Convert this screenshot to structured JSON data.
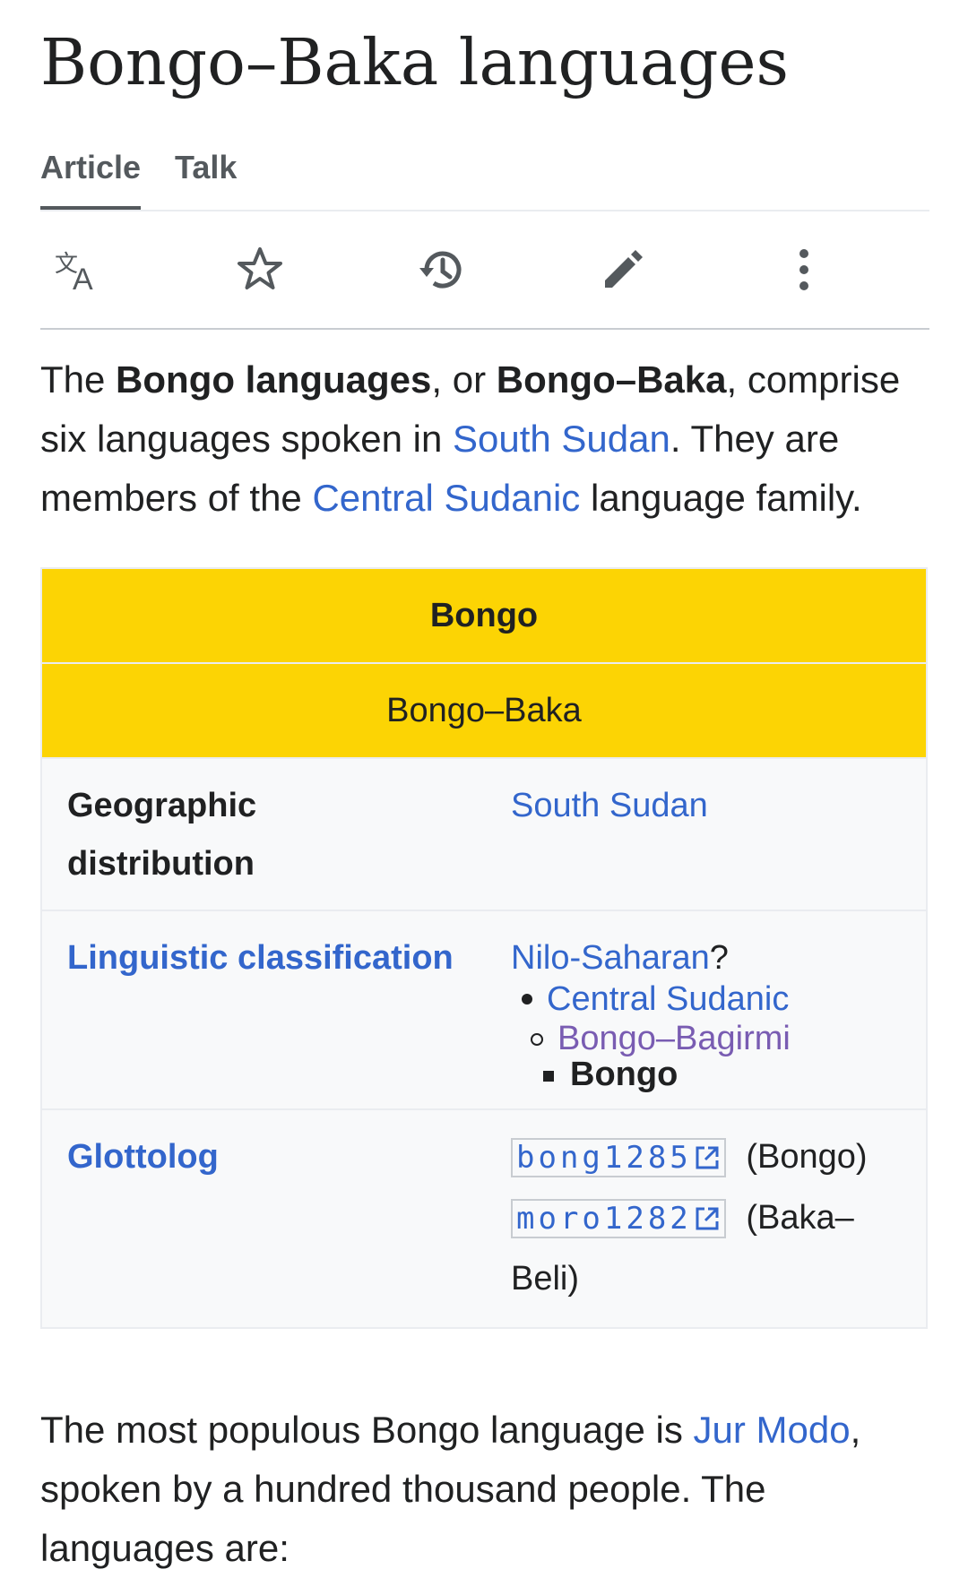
{
  "page": {
    "title": "Bongo–Baka languages"
  },
  "tabs": [
    {
      "label": "Article",
      "active": true
    },
    {
      "label": "Talk",
      "active": false
    }
  ],
  "toolbar": {
    "icons": [
      "language-icon",
      "star-icon",
      "history-icon",
      "edit-pencil-icon",
      "more-vertical-icon"
    ]
  },
  "intro": {
    "t1": "The ",
    "b1": "Bongo languages",
    "t2": ", or ",
    "b2": "Bongo–Baka",
    "t3": ", comprise six languages spoken in ",
    "link1": "South Sudan",
    "t4": ". They are members of the ",
    "link2": "Central Sudanic",
    "t5": " language family."
  },
  "infobox": {
    "title": "Bongo",
    "subtitle": "Bongo–Baka",
    "geo_label": "Geographic distribution",
    "geo_value": "South Sudan",
    "class_label": "Linguistic classification",
    "class_root": "Nilo-Saharan",
    "class_root_suffix": "?",
    "class_level1": "Central Sudanic",
    "class_level2": "Bongo–Bagirmi",
    "class_level3": "Bongo",
    "glotto_label": "Glottolog",
    "glotto_code1": "bong1285",
    "glotto_note1": "(Bongo)",
    "glotto_code2": "moro1282",
    "glotto_note2a": "(Baka–",
    "glotto_note2b": "Beli)",
    "header_color": "#fcd404"
  },
  "body": {
    "t1": "The most populous Bongo language is ",
    "link1": "Jur Modo",
    "t2": ", spoken by a hundred thousand people. The languages are:"
  },
  "colors": {
    "link": "#3366cc",
    "visited": "#795cb2",
    "text": "#202122"
  }
}
